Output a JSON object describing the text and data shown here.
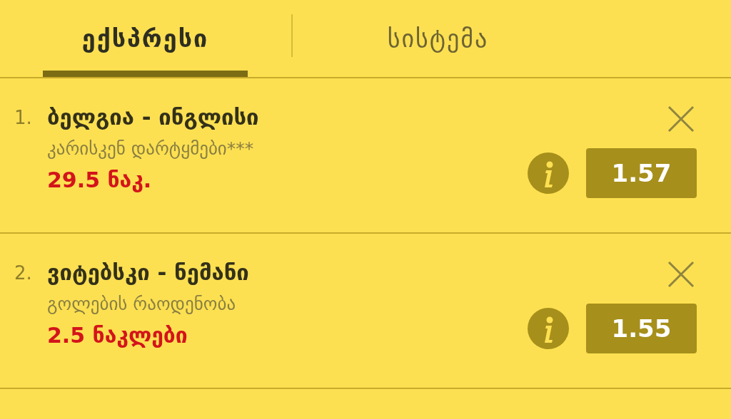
{
  "tabs": [
    {
      "label": "ექსპრესი",
      "selected": true
    },
    {
      "label": "სისტემა",
      "selected": false
    }
  ],
  "bets": [
    {
      "number": "1.",
      "match": "ბელგია - ინგლისი",
      "market": "კარისკენ დარტყმები***",
      "pick": "29.5 ნაკ.",
      "odds": "1.57"
    },
    {
      "number": "2.",
      "match": "ვიტებსკი - ნემანი",
      "market": "გოლების რაოდენობა",
      "pick": "2.5 ნაკლები",
      "odds": "1.55"
    }
  ]
}
